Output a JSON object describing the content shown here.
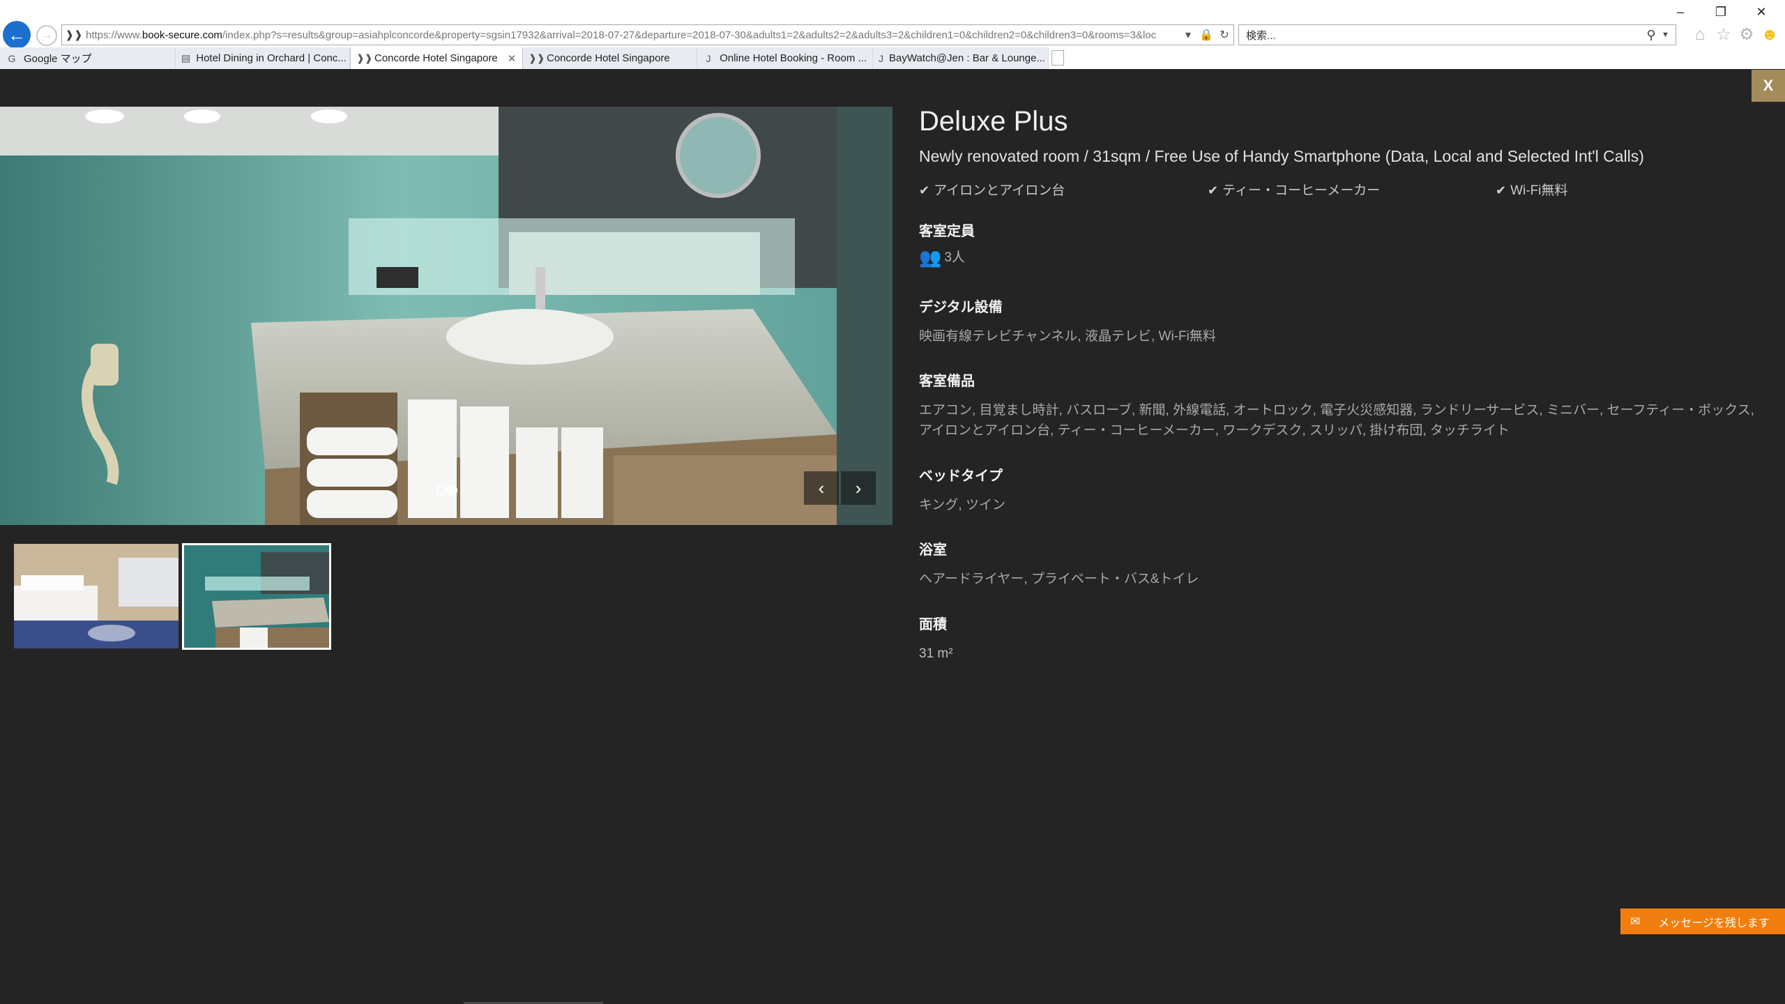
{
  "browser": {
    "address": {
      "prefix": "https://www.",
      "domain": "book-secure.com",
      "path": "/index.php?s=results&group=asiahplconcorde&property=sgsin17932&arrival=2018-07-27&departure=2018-07-30&adults1=2&adults2=2&adults3=2&children1=0&children2=0&children3=0&rooms=3&loc"
    },
    "search_placeholder": "検索...",
    "tabs": [
      {
        "label": "Google マップ",
        "icon": "google-icon"
      },
      {
        "label": "Hotel Dining in Orchard | Conc...",
        "icon": "page-icon"
      },
      {
        "label": "Concorde Hotel Singapore",
        "icon": "site-icon",
        "active": true
      },
      {
        "label": "Concorde Hotel Singapore",
        "icon": "site-icon"
      },
      {
        "label": "Online Hotel Booking - Room ...",
        "icon": "j-icon"
      },
      {
        "label": "BayWatch@Jen : Bar & Lounge...",
        "icon": "j-icon"
      }
    ]
  },
  "modal": {
    "close_label": "X",
    "carousel": {
      "current": 2,
      "total": 2
    },
    "room": {
      "title": "Deluxe Plus",
      "subtitle": "Newly renovated room / 31sqm / Free Use of Handy Smartphone (Data, Local and Selected Int'l Calls)",
      "features": [
        "アイロンとアイロン台",
        "ティー・コーヒーメーカー",
        "Wi-Fi無料"
      ],
      "sections": [
        {
          "heading": "客室定員",
          "value": "3人"
        },
        {
          "heading": "デジタル設備",
          "value": "映画有線テレビチャンネル, 液晶テレビ, Wi-Fi無料"
        },
        {
          "heading": "客室備品",
          "value": "エアコン, 目覚まし時計, バスローブ, 新聞, 外線電話, オートロック, 電子火災感知器, ランドリーサービス, ミニバー, セーフティー・ボックス, アイロンとアイロン台, ティー・コーヒーメーカー, ワークデスク, スリッパ, 掛け布団, タッチライト"
        },
        {
          "heading": "ベッドタイプ",
          "value": "キング, ツイン"
        },
        {
          "heading": "浴室",
          "value": "ヘアードライヤー, プライベート・バス&トイレ"
        },
        {
          "heading": "面積",
          "value": "31 m²"
        }
      ]
    }
  },
  "chat": {
    "label": "メッセージを残します"
  },
  "colors": {
    "page_bg": "#242424",
    "accent_gold": "#a48b5a",
    "chat_orange": "#f07e0f",
    "browser_blue": "#1c6fce"
  }
}
